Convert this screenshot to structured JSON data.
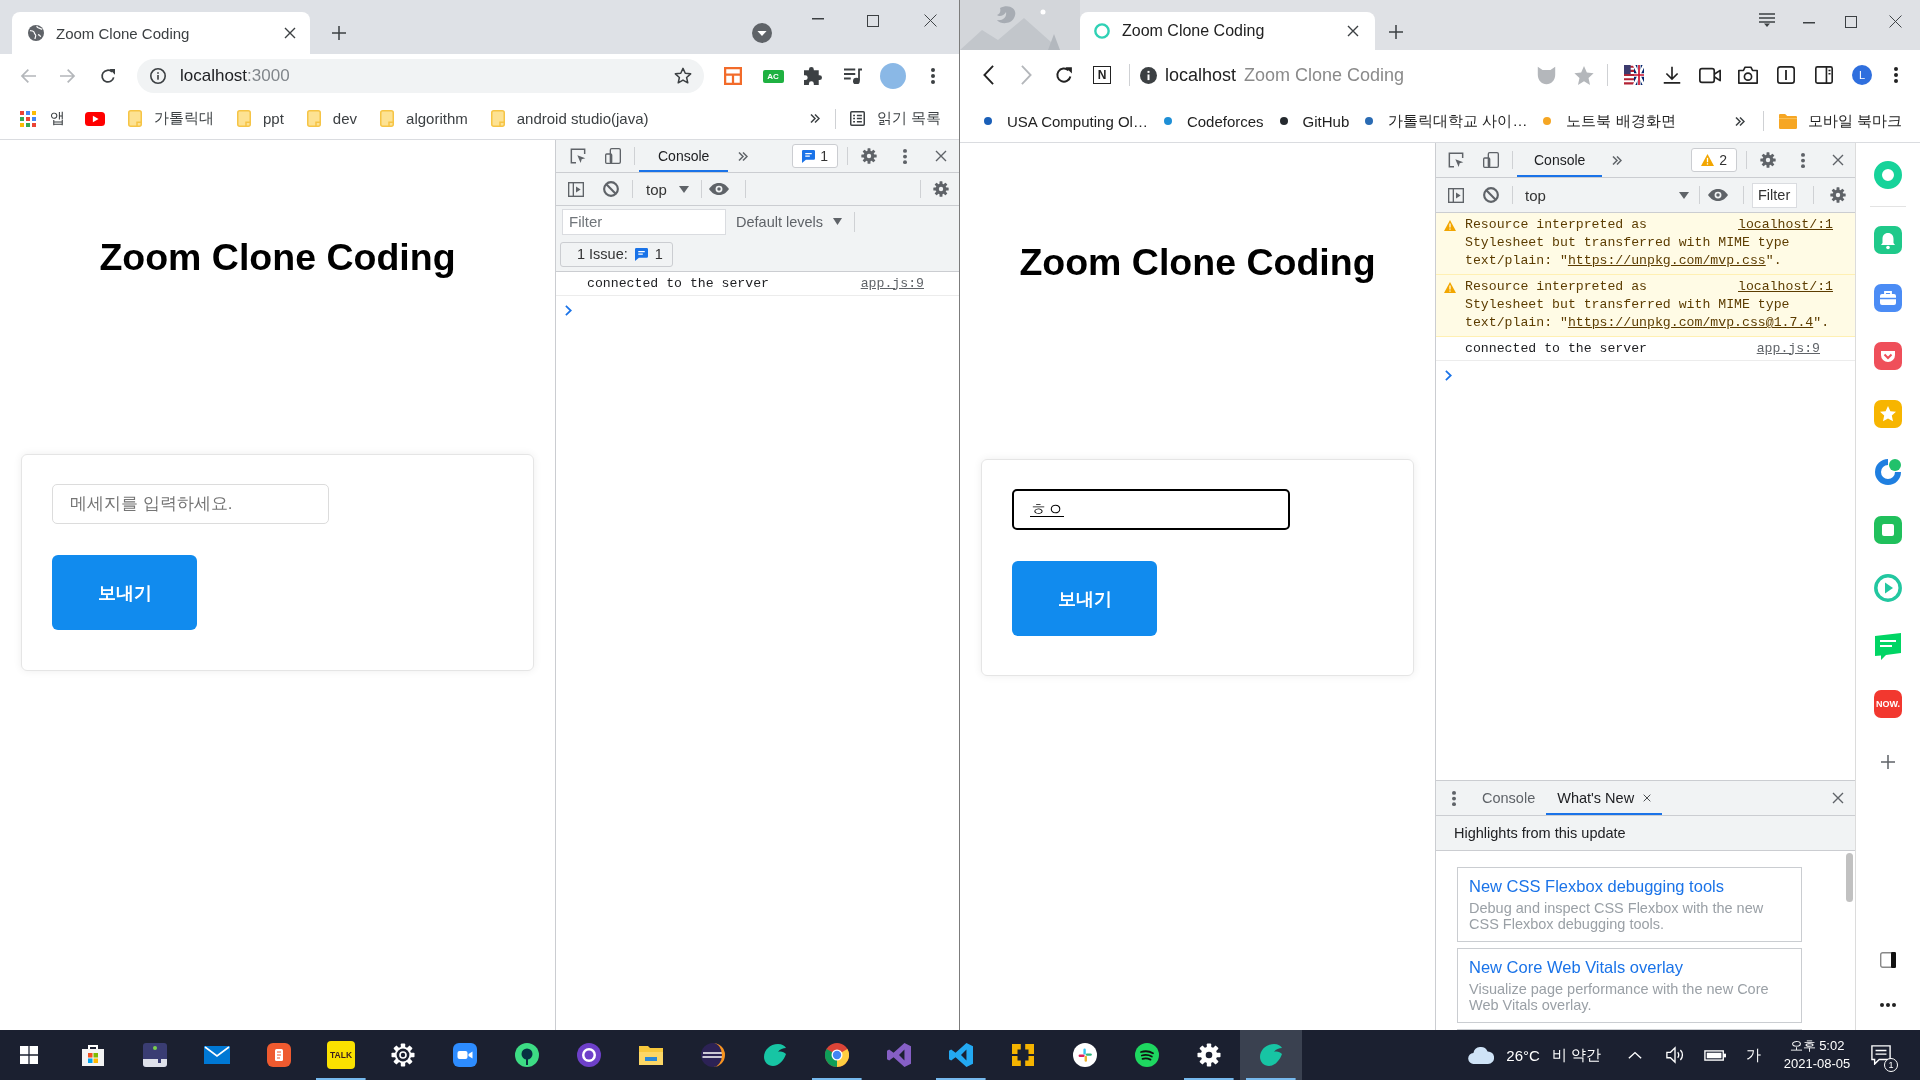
{
  "left_window": {
    "tab": {
      "title": "Zoom Clone Coding"
    },
    "address": {
      "host": "localhost",
      "port": ":3000"
    },
    "extension_badge": "AC",
    "bookmarks": {
      "apps": "앱",
      "folders": [
        "가톨릭대",
        "ppt",
        "dev",
        "algorithm",
        "android studio(java)"
      ],
      "reading_list": "읽기 목록"
    },
    "page": {
      "heading": "Zoom Clone Coding",
      "message_field": {
        "placeholder": "메세지를 입력하세요.",
        "focused": false
      },
      "send_button": "보내기"
    },
    "devtools": {
      "tabs": [
        {
          "label": "Console",
          "selected": true
        }
      ],
      "issues_badge": "1",
      "context": "top",
      "filter_bar": {
        "filter": {
          "placeholder": "Filter"
        },
        "levels": "Default levels"
      },
      "issues": {
        "label": "1 Issue:",
        "count": "1"
      },
      "messages": [
        {
          "kind": "log",
          "text": "connected to the server",
          "source": "app.js:9"
        }
      ]
    }
  },
  "right_window": {
    "tab": {
      "title": "Zoom Clone Coding"
    },
    "n_button": "N",
    "address": {
      "host": "localhost",
      "page_title": "Zoom Clone Coding"
    },
    "profile_initial": "L",
    "bookmarks": [
      {
        "label": "USA Computing Ol…",
        "color": "#1a5fb8"
      },
      {
        "label": "Codeforces",
        "color": "#1e8fd6"
      },
      {
        "label": "GitHub",
        "color": "#24292e"
      },
      {
        "label": "가톨릭대학교 사이…",
        "color": "#2a6bb3"
      },
      {
        "label": "노트북 배경화면",
        "color": "#f5a623"
      }
    ],
    "mobile_bookmarks": "모바일 북마크",
    "page": {
      "heading": "Zoom Clone Coding",
      "message_field": {
        "value": "ㅎㅇ",
        "focused": true,
        "composing": true
      },
      "send_button": "보내기"
    },
    "devtools": {
      "tabs": [
        {
          "label": "Console",
          "selected": true
        }
      ],
      "warnings_badge": "2",
      "context": "top",
      "filter": {
        "placeholder": "Filter"
      },
      "messages": [
        {
          "kind": "warning",
          "text": "Resource interpreted as Stylesheet but transferred with MIME type text/plain: \"",
          "link": "https://unpkg.com/mvp.css",
          "text_after": "\".",
          "source": "localhost/:1"
        },
        {
          "kind": "warning",
          "text": "Resource interpreted as Stylesheet but transferred with MIME type text/plain: \"",
          "link": "https://unpkg.com/mvp.css@1.7.4",
          "text_after": "\".",
          "source": "localhost/:1"
        },
        {
          "kind": "log",
          "text": "connected to the server",
          "source": "app.js:9"
        }
      ],
      "drawer": {
        "tabs": [
          {
            "label": "Console",
            "selected": false,
            "closable": false
          },
          {
            "label": "What's New",
            "selected": true,
            "closable": true
          }
        ],
        "heading": "Highlights from this update",
        "cards": [
          {
            "title": "New CSS Flexbox debugging tools",
            "description": "Debug and inspect CSS Flexbox with the new CSS Flexbox debugging tools."
          },
          {
            "title": "New Core Web Vitals overlay",
            "description": "Visualize page performance with the new Core Web Vitals overlay."
          }
        ]
      }
    },
    "side_panel": {
      "now_badge": "NOW."
    }
  },
  "taskbar": {
    "apps": [
      {
        "running": false,
        "active": false
      },
      {
        "running": false,
        "active": false
      },
      {
        "running": false,
        "active": false
      },
      {
        "running": false,
        "active": false
      },
      {
        "running": true,
        "active": false,
        "label": "TALK"
      },
      {
        "running": false,
        "active": false
      },
      {
        "running": false,
        "active": false
      },
      {
        "running": false,
        "active": false
      },
      {
        "running": false,
        "active": false
      },
      {
        "running": false,
        "active": false
      },
      {
        "running": false,
        "active": false
      },
      {
        "running": false,
        "active": false
      },
      {
        "running": true,
        "active": false
      },
      {
        "running": false,
        "active": false
      },
      {
        "running": true,
        "active": false
      },
      {
        "running": false,
        "active": false
      },
      {
        "running": false,
        "active": false
      },
      {
        "running": false,
        "active": false
      },
      {
        "running": true,
        "active": false
      },
      {
        "running": true,
        "active": true
      }
    ],
    "weather": {
      "temperature": "26°C",
      "condition": "비 약간"
    },
    "input_mode": "가",
    "clock": {
      "time": "오후 5:02",
      "date": "2021-08-05"
    },
    "notifications": "1"
  }
}
